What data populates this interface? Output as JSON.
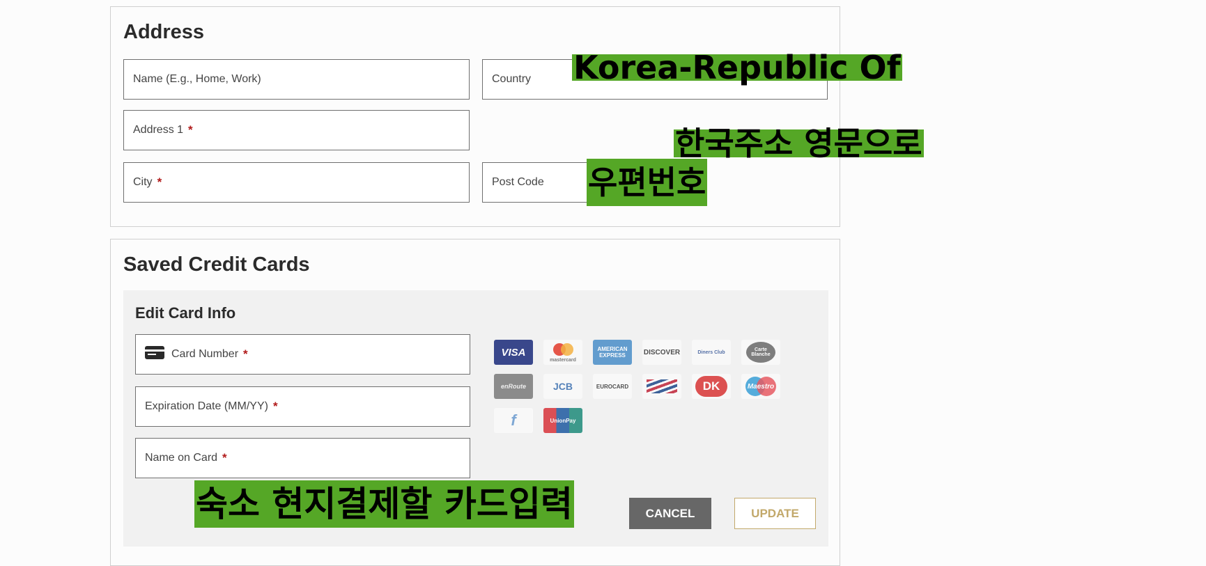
{
  "address": {
    "title": "Address",
    "fields": {
      "name_placeholder": "Name (E.g., Home, Work)",
      "country_label": "Country",
      "address1_label": "Address 1",
      "city_label": "City",
      "postcode_label": "Post Code"
    }
  },
  "required_mark": "*",
  "cards": {
    "title": "Saved Credit Cards",
    "edit_title": "Edit Card Info",
    "fields": {
      "card_number_label": "Card Number",
      "expiry_label": "Expiration Date (MM/YY)",
      "name_on_card_label": "Name on Card"
    },
    "logos": [
      "VISA",
      "mastercard",
      "AMERICAN EXPRESS",
      "DISCOVER",
      "Diners Club",
      "Carte Blanche",
      "enRoute",
      "JCB",
      "EUROCARD",
      "Bank",
      "DK",
      "Maestro",
      "f",
      "UnionPay"
    ],
    "cancel_label": "CANCEL",
    "update_label": "UPDATE"
  },
  "annotations": {
    "country_value": "Korea-Republic Of",
    "korean_address": "한국주소 영문으로",
    "postcode": "우편번호",
    "card_note": "숙소 현지결제할 카드입력"
  },
  "colors": {
    "highlight": "#55a726",
    "required": "#b11a1a",
    "cancel_bg": "#676767",
    "update_border": "#c2a86a"
  }
}
